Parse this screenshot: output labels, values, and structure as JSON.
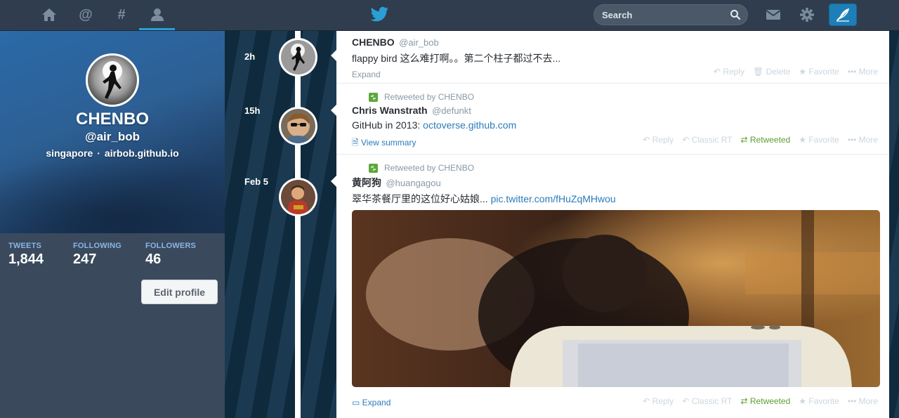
{
  "nav": {
    "items": [
      {
        "name": "home"
      },
      {
        "name": "connect"
      },
      {
        "name": "discover"
      },
      {
        "name": "me"
      }
    ],
    "search_placeholder": "Search"
  },
  "profile": {
    "name": "CHENBO",
    "handle": "@air_bob",
    "location": "singapore",
    "separator": "·",
    "website": "airbob.github.io",
    "stats": [
      {
        "label": "TWEETS",
        "value": "1,844"
      },
      {
        "label": "FOLLOWING",
        "value": "247"
      },
      {
        "label": "FOLLOWERS",
        "value": "46"
      }
    ],
    "edit_label": "Edit profile"
  },
  "tweets": [
    {
      "time": "2h",
      "name": "CHENBO",
      "handle": "@air_bob",
      "text": "flappy bird 这么难打啊。。第二个柱子都过不去...",
      "footer_link": "Expand",
      "actions": [
        "Reply",
        "Delete",
        "Favorite",
        "More"
      ]
    },
    {
      "time": "15h",
      "retweeted_by": "Retweeted by CHENBO",
      "name": "Chris Wanstrath",
      "handle": "@defunkt",
      "text": "GitHub in 2013: ",
      "link": "octoverse.github.com",
      "footer_link": "View summary",
      "actions": [
        "Reply",
        "Classic RT",
        "Retweeted",
        "Favorite",
        "More"
      ]
    },
    {
      "time": "Feb 5",
      "retweeted_by": "Retweeted by CHENBO",
      "name": "黄阿狗",
      "handle": "@huangagou",
      "text": "翠华茶餐厅里的这位好心姑娘... ",
      "link": "pic.twitter.com/fHuZqMHwou",
      "footer_link": "Expand",
      "actions": [
        "Reply",
        "Classic RT",
        "Retweeted",
        "Favorite",
        "More"
      ]
    }
  ],
  "colors": {
    "topbar": "#2f3d4e",
    "accent": "#2a9fd6",
    "link": "#2b7bb9",
    "retweet_green": "#5c9e31"
  }
}
